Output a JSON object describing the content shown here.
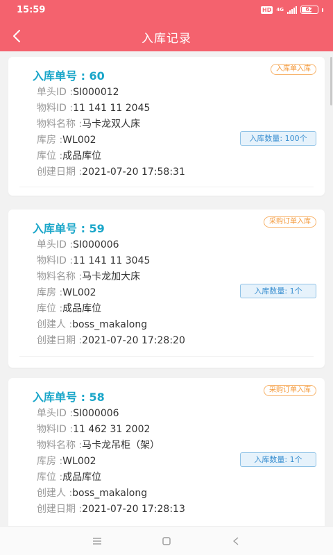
{
  "status_bar": {
    "time": "15:59",
    "hd": "HD",
    "network": "4G",
    "battery": "62",
    "battery_level": 0.62
  },
  "nav": {
    "title": "入库记录",
    "back_icon": "chevron-left-icon"
  },
  "labels": {
    "header_id": "单头ID :",
    "material_id": "物料ID :",
    "material_name": "物料名称 :",
    "warehouse": "库房 :",
    "location": "库位 :",
    "creator": "创建人 :",
    "created_date": "创建日期 :"
  },
  "records": [
    {
      "title": "入库单号 : 60",
      "type": "入库单入库",
      "header_id": "SI000012",
      "material_id": "11 141 11 2045",
      "material_name": "马卡龙双人床",
      "warehouse": "WL002",
      "location": "成品库位",
      "creator": "",
      "created_date": "2021-07-20 17:58:31",
      "quantity": "入库数量: 100个"
    },
    {
      "title": "入库单号 : 59",
      "type": "采购订单入库",
      "header_id": "SI000006",
      "material_id": "11 141 11 3045",
      "material_name": "马卡龙加大床",
      "warehouse": "WL002",
      "location": "成品库位",
      "creator": "boss_makalong",
      "created_date": "2021-07-20 17:28:20",
      "quantity": "入库数量: 1个"
    },
    {
      "title": "入库单号 : 58",
      "type": "采购订单入库",
      "header_id": "SI000006",
      "material_id": "11 462 31 2002",
      "material_name": "马卡龙吊柜（架）",
      "warehouse": "WL002",
      "location": "成品库位",
      "creator": "boss_makalong",
      "created_date": "2021-07-20 17:28:13",
      "quantity": "入库数量: 1个"
    }
  ],
  "system_nav": [
    "menu-icon",
    "home-square-icon",
    "back-triangle-icon"
  ],
  "colors": {
    "header": "#f4626e",
    "title_blue": "#1aa6c9",
    "tag_orange": "#f49a3c",
    "qty_blue": "#3a8fd0",
    "background": "#f2f2f2"
  }
}
